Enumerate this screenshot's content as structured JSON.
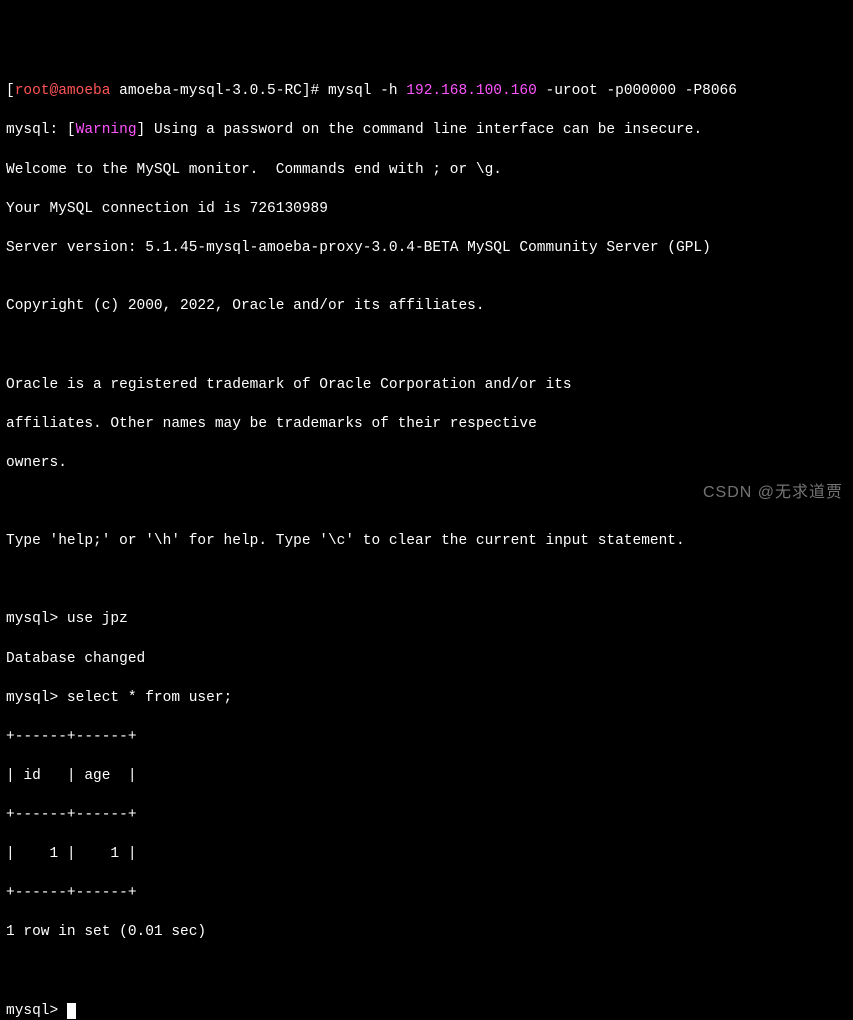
{
  "prompt1": {
    "open": "[",
    "user": "root@amoeba",
    "space1": " ",
    "dir": "amoeba-mysql-3.0.5-RC",
    "close": "]#",
    "space2": " ",
    "cmd_pre": "mysql -h ",
    "ip": "192.168.100.160",
    "cmd_post": " -uroot -p000000 -P8066"
  },
  "warn": {
    "pre": "mysql: [",
    "word": "Warning",
    "post": "] Using a password on the command line interface can be insecure."
  },
  "lines": {
    "welcome": "Welcome to the MySQL monitor.  Commands end with ; or \\g.",
    "connid": "Your MySQL connection id is 726130989",
    "server": "Server version: 5.1.45-mysql-amoeba-proxy-3.0.4-BETA MySQL Community Server (GPL)",
    "blank": "",
    "copyright": "Copyright (c) 2000, 2022, Oracle and/or its affiliates.",
    "trademark1": "Oracle is a registered trademark of Oracle Corporation and/or its",
    "trademark2": "affiliates. Other names may be trademarks of their respective",
    "trademark3": "owners.",
    "help": "Type 'help;' or '\\h' for help. Type '\\c' to clear the current input statement.",
    "use": "mysql> use jpz",
    "dbchanged": "Database changed",
    "select": "mysql> select * from user;",
    "border": "+------+------+",
    "header": "| id   | age  |",
    "row": "|    1 |    1 |",
    "rowcount": "1 row in set (0.01 sec)",
    "prompt_end": "mysql> "
  },
  "watermark": "CSDN @无求道贾"
}
